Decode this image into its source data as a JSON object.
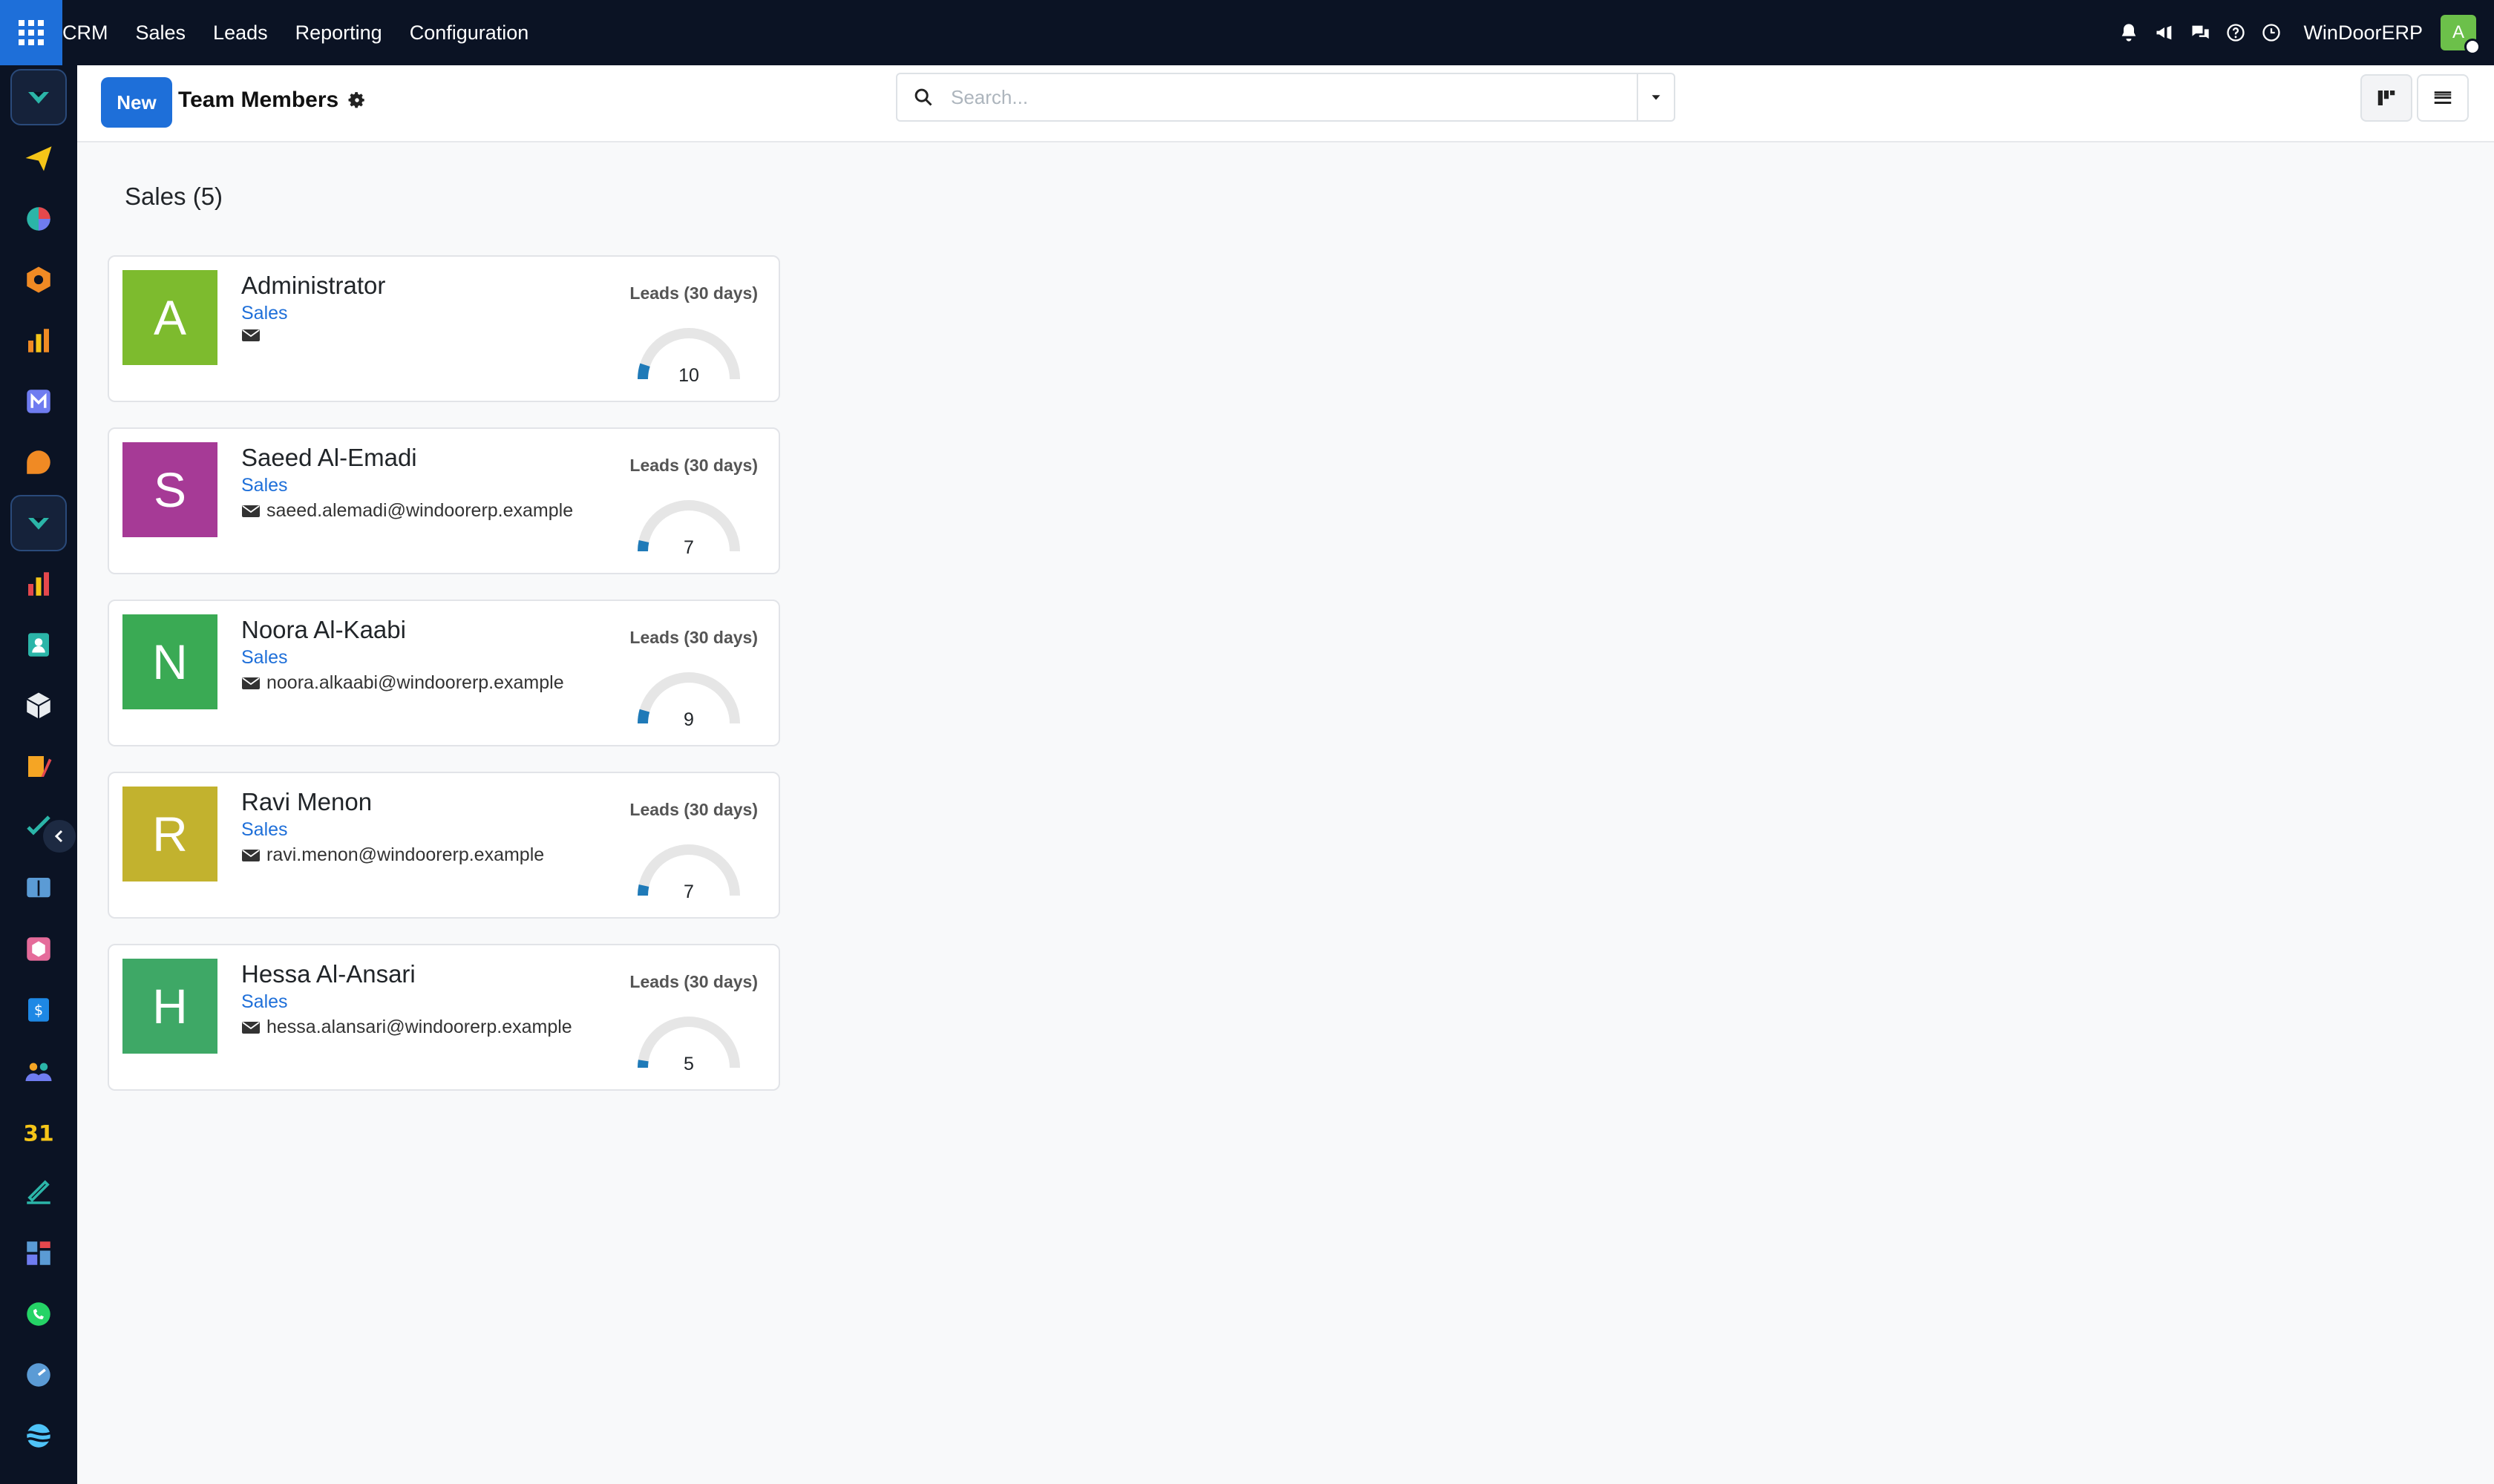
{
  "topbar": {
    "menu": [
      "CRM",
      "Sales",
      "Leads",
      "Reporting",
      "Configuration"
    ],
    "company": "WinDoorERP",
    "user_initial": "A",
    "icons": [
      "bell-icon",
      "megaphone-icon",
      "chat-icon",
      "help-icon",
      "clock-icon"
    ]
  },
  "sidebar": {
    "apps": [
      {
        "icon": "crm-icon",
        "color": "#2bb5a8"
      },
      {
        "icon": "paper-plane-icon",
        "color": "#f5c518"
      },
      {
        "icon": "pie-icon",
        "color": "#e5484d"
      },
      {
        "icon": "box-hex-icon",
        "color": "#f08a24"
      },
      {
        "icon": "bars-icon",
        "color": "#f08a24"
      },
      {
        "icon": "mail-m-icon",
        "color": "#6f7cf0"
      },
      {
        "icon": "chat-bubble-icon",
        "color": "#f08a24"
      },
      {
        "icon": "crm-icon",
        "color": "#2bb5a8"
      },
      {
        "icon": "bars-icon",
        "color": "#e5484d"
      },
      {
        "icon": "contact-icon",
        "color": "#2bb5a8"
      },
      {
        "icon": "cube-icon",
        "color": "#e9ecef"
      },
      {
        "icon": "palette-icon",
        "color": "#f5a524"
      },
      {
        "icon": "check-icon",
        "color": "#2bb5a8"
      },
      {
        "icon": "book-icon",
        "color": "#5b9bd5"
      },
      {
        "icon": "cube-box-icon",
        "color": "#e56b9a"
      },
      {
        "icon": "dollar-icon",
        "color": "#1e88e5"
      },
      {
        "icon": "people-icon",
        "color": "#f5a524"
      },
      {
        "icon": "calendar-31-icon",
        "color": "#f5c518"
      },
      {
        "icon": "sign-icon",
        "color": "#2bb5a8"
      },
      {
        "icon": "dashboard-icon",
        "color": "#5b9bd5"
      },
      {
        "icon": "whatsapp-icon",
        "color": "#25d366"
      },
      {
        "icon": "clock-dial-icon",
        "color": "#5b9bd5"
      },
      {
        "icon": "wave-icon",
        "color": "#4fc3f7"
      }
    ]
  },
  "control": {
    "new_label": "New",
    "title": "Team Members",
    "search_placeholder": "Search..."
  },
  "group": {
    "title": "Sales (5)"
  },
  "members": [
    {
      "initial": "A",
      "name": "Administrator",
      "team": "Sales",
      "email": "",
      "leads_label": "Leads (30 days)",
      "leads": 10,
      "color": "#7dbb2e"
    },
    {
      "initial": "S",
      "name": "Saeed Al-Emadi",
      "team": "Sales",
      "email": "saeed.alemadi@windoorerp.example",
      "leads_label": "Leads (30 days)",
      "leads": 7,
      "color": "#a63a96"
    },
    {
      "initial": "N",
      "name": "Noora Al-Kaabi",
      "team": "Sales",
      "email": "noora.alkaabi@windoorerp.example",
      "leads_label": "Leads (30 days)",
      "leads": 9,
      "color": "#3aaa54"
    },
    {
      "initial": "R",
      "name": "Ravi Menon",
      "team": "Sales",
      "email": "ravi.menon@windoorerp.example",
      "leads_label": "Leads (30 days)",
      "leads": 7,
      "color": "#c2b22e"
    },
    {
      "initial": "H",
      "name": "Hessa Al-Ansari",
      "team": "Sales",
      "email": "hessa.alansari@windoorerp.example",
      "leads_label": "Leads (30 days)",
      "leads": 5,
      "color": "#3ea866"
    }
  ],
  "gauge": {
    "max": 100,
    "fill_color": "#1f7ab8",
    "track_color": "#e6e6e6"
  }
}
